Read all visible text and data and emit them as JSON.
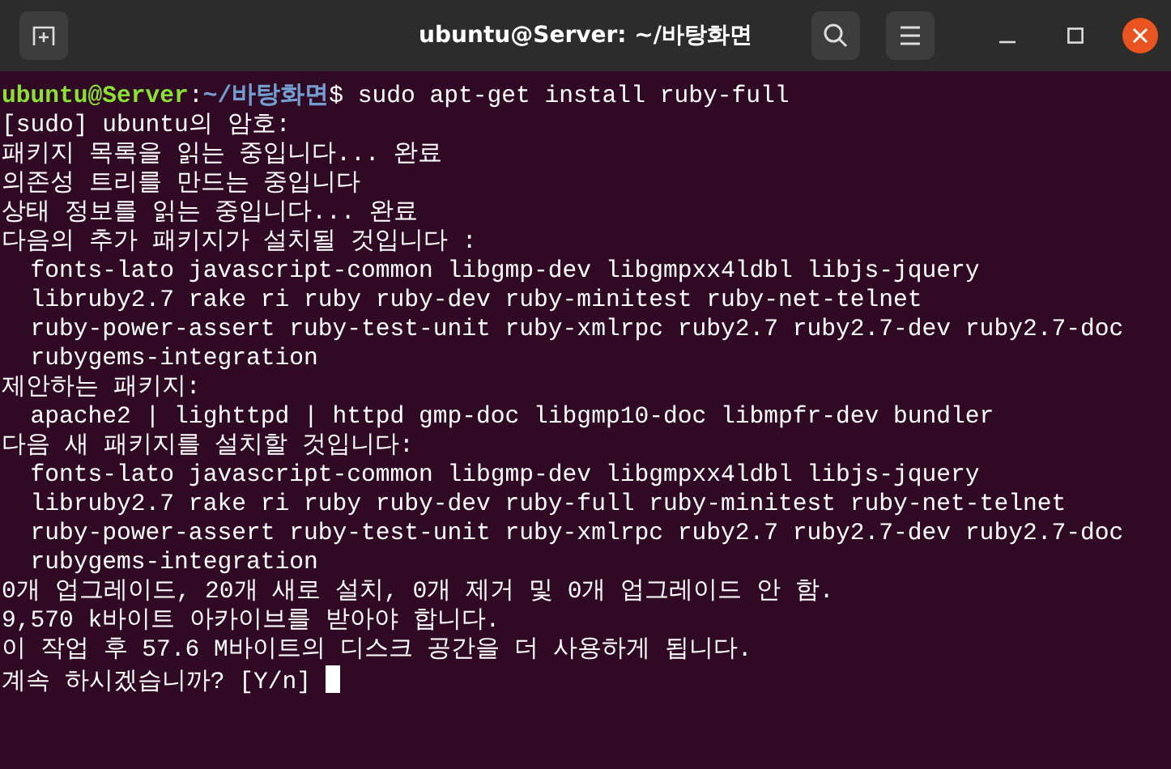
{
  "window": {
    "title": "ubuntu@Server: ~/바탕화면"
  },
  "terminal": {
    "cursor_visible": true,
    "lines": [
      {
        "kind": "prompt",
        "segments": [
          {
            "text": "ubuntu@Server",
            "color": "#8ae234"
          },
          {
            "text": ":",
            "color": "#ffffff"
          },
          {
            "text": "~/바탕화면",
            "color": "#729fcf"
          },
          {
            "text": "$ sudo apt-get install ruby-full",
            "color": "#ffffff"
          }
        ]
      },
      {
        "kind": "output",
        "text": "[sudo] ubuntu의 암호:"
      },
      {
        "kind": "output",
        "text": "패키지 목록을 읽는 중입니다... 완료"
      },
      {
        "kind": "output",
        "text": "의존성 트리를 만드는 중입니다"
      },
      {
        "kind": "output",
        "text": "상태 정보를 읽는 중입니다... 완료"
      },
      {
        "kind": "output",
        "text": "다음의 추가 패키지가 설치될 것입니다 :"
      },
      {
        "kind": "output",
        "text": "  fonts-lato javascript-common libgmp-dev libgmpxx4ldbl libjs-jquery"
      },
      {
        "kind": "output",
        "text": "  libruby2.7 rake ri ruby ruby-dev ruby-minitest ruby-net-telnet"
      },
      {
        "kind": "output",
        "text": "  ruby-power-assert ruby-test-unit ruby-xmlrpc ruby2.7 ruby2.7-dev ruby2.7-doc"
      },
      {
        "kind": "output",
        "text": "  rubygems-integration"
      },
      {
        "kind": "output",
        "text": "제안하는 패키지:"
      },
      {
        "kind": "output",
        "text": "  apache2 | lighttpd | httpd gmp-doc libgmp10-doc libmpfr-dev bundler"
      },
      {
        "kind": "output",
        "text": "다음 새 패키지를 설치할 것입니다:"
      },
      {
        "kind": "output",
        "text": "  fonts-lato javascript-common libgmp-dev libgmpxx4ldbl libjs-jquery"
      },
      {
        "kind": "output",
        "text": "  libruby2.7 rake ri ruby ruby-dev ruby-full ruby-minitest ruby-net-telnet"
      },
      {
        "kind": "output",
        "text": "  ruby-power-assert ruby-test-unit ruby-xmlrpc ruby2.7 ruby2.7-dev ruby2.7-doc"
      },
      {
        "kind": "output",
        "text": "  rubygems-integration"
      },
      {
        "kind": "output",
        "text": "0개 업그레이드, 20개 새로 설치, 0개 제거 및 0개 업그레이드 안 함."
      },
      {
        "kind": "output",
        "text": "9,570 k바이트 아카이브를 받아야 합니다."
      },
      {
        "kind": "output",
        "text": "이 작업 후 57.6 M바이트의 디스크 공간을 더 사용하게 됩니다."
      },
      {
        "kind": "input",
        "text": "계속 하시겠습니까? [Y/n]"
      }
    ]
  }
}
